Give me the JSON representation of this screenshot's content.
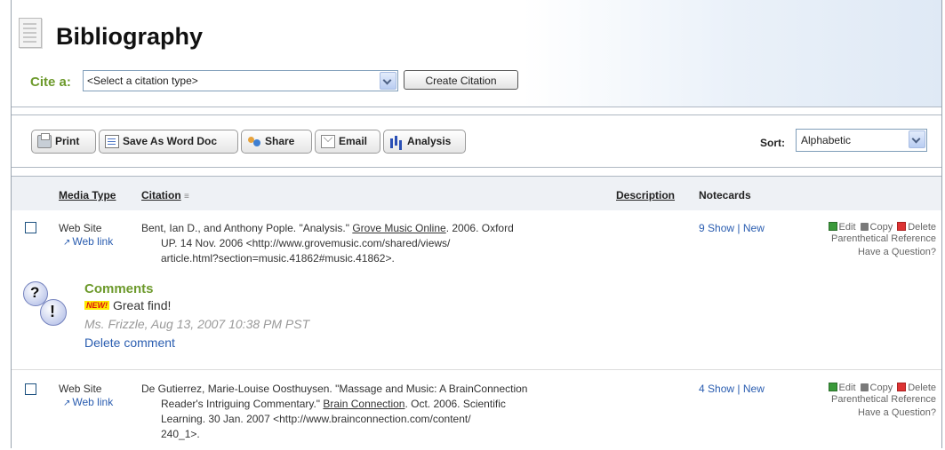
{
  "header": {
    "title": "Bibliography",
    "cite_label": "Cite a:",
    "citation_type_select": "<Select a citation type>",
    "create_button": "Create Citation"
  },
  "toolbar": {
    "print": "Print",
    "save_word": "Save As Word Doc",
    "share": "Share",
    "email": "Email",
    "analysis": "Analysis",
    "sort_label": "Sort:",
    "sort_value": "Alphabetic"
  },
  "table": {
    "col_media": "Media Type",
    "col_citation": "Citation",
    "col_description": "Description",
    "col_notecards": "Notecards",
    "rows": [
      {
        "media_type": "Web Site",
        "web_link": "Web link",
        "citation_pre": "Bent, Ian D., and Anthony Pople. \"Analysis.\" ",
        "citation_source": "Grove Music Online",
        "citation_post": ". 2006. Oxford",
        "citation_line2": "UP. 14 Nov. 2006 <http://www.grovemusic.com/shared/views/",
        "citation_line3": "article.html?section=music.41862#music.41862>.",
        "notecard_count": "9",
        "show": "Show",
        "new": "New",
        "edit": "Edit",
        "copy": "Copy",
        "delete": "Delete",
        "parenthetical": "Parenthetical Reference",
        "question": "Have a Question?"
      },
      {
        "media_type": "Web Site",
        "web_link": "Web link",
        "citation_pre": "De Gutierrez, Marie-Louise Oosthuysen. \"Massage and Music: A BrainConnection",
        "citation_line2_pre": "Reader's Intriguing Commentary.\" ",
        "citation_source": "Brain Connection",
        "citation_line2_post": ". Oct. 2006. Scientific",
        "citation_line3": "Learning. 30 Jan. 2007 <http://www.brainconnection.com/content/",
        "citation_line4": "240_1>.",
        "notecard_count": "4",
        "show": "Show",
        "new": "New",
        "edit": "Edit",
        "copy": "Copy",
        "delete": "Delete",
        "parenthetical": "Parenthetical Reference",
        "question": "Have a Question?"
      }
    ]
  },
  "comments": {
    "title": "Comments",
    "new_badge": "NEW!",
    "text": "Great find!",
    "meta": "Ms. Frizzle, Aug 13, 2007 10:38 PM PST",
    "delete": "Delete comment"
  },
  "colors": {
    "accent_green": "#6d9a2c",
    "link_blue": "#2a5db0"
  }
}
